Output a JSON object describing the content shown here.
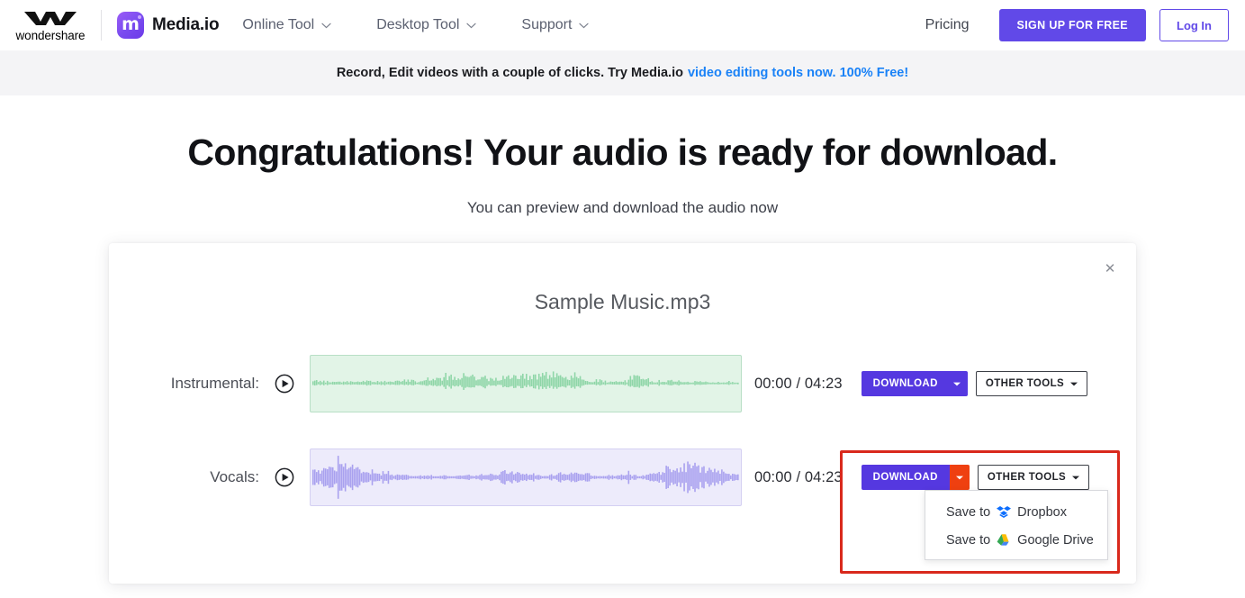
{
  "header": {
    "wondershare_wordmark": "wondershare",
    "brand_name": "Media.io",
    "brand_logo_letter": "m",
    "nav": [
      {
        "label": "Online Tool",
        "icon": "chevron-down-icon"
      },
      {
        "label": "Desktop Tool",
        "icon": "chevron-down-icon"
      },
      {
        "label": "Support",
        "icon": "chevron-down-icon"
      }
    ],
    "pricing_label": "Pricing",
    "signup_label": "SIGN UP FOR FREE",
    "login_label": "Log In",
    "accent_color": "#6149e8"
  },
  "promo": {
    "text": "Record, Edit videos with a couple of clicks. Try Media.io",
    "link_text": "video editing tools now. 100% Free!",
    "link_color": "#1a82f7",
    "background": "#f4f4f6"
  },
  "hero": {
    "title": "Congratulations! Your audio is ready for download.",
    "subtitle": "You can preview and download the audio now"
  },
  "card": {
    "title": "Sample Music.mp3",
    "close_icon": "✕",
    "tracks": [
      {
        "label": "Instrumental:",
        "play_icon": "play-circle-icon",
        "waveform_color": "#8fd6a8",
        "waveform_bg": "#e2f4e7",
        "time_current": "00:00",
        "time_total": "04:23",
        "time_display": "00:00 / 04:23",
        "download_label": "DOWNLOAD",
        "other_tools_label": "OTHER TOOLS",
        "download_active": false
      },
      {
        "label": "Vocals:",
        "play_icon": "play-circle-icon",
        "waveform_color": "#a9a1ef",
        "waveform_bg": "#edebfb",
        "time_current": "00:00",
        "time_total": "04:23",
        "time_display": "00:00 / 04:23",
        "download_label": "DOWNLOAD",
        "other_tools_label": "OTHER TOOLS",
        "download_active": true
      }
    ]
  },
  "dropdown": {
    "items": [
      {
        "prefix": "Save to",
        "service": "Dropbox",
        "icon": "dropbox-icon"
      },
      {
        "prefix": "Save to",
        "service": "Google Drive",
        "icon": "google-drive-icon"
      }
    ]
  },
  "highlight": {
    "color": "#d9291c"
  }
}
